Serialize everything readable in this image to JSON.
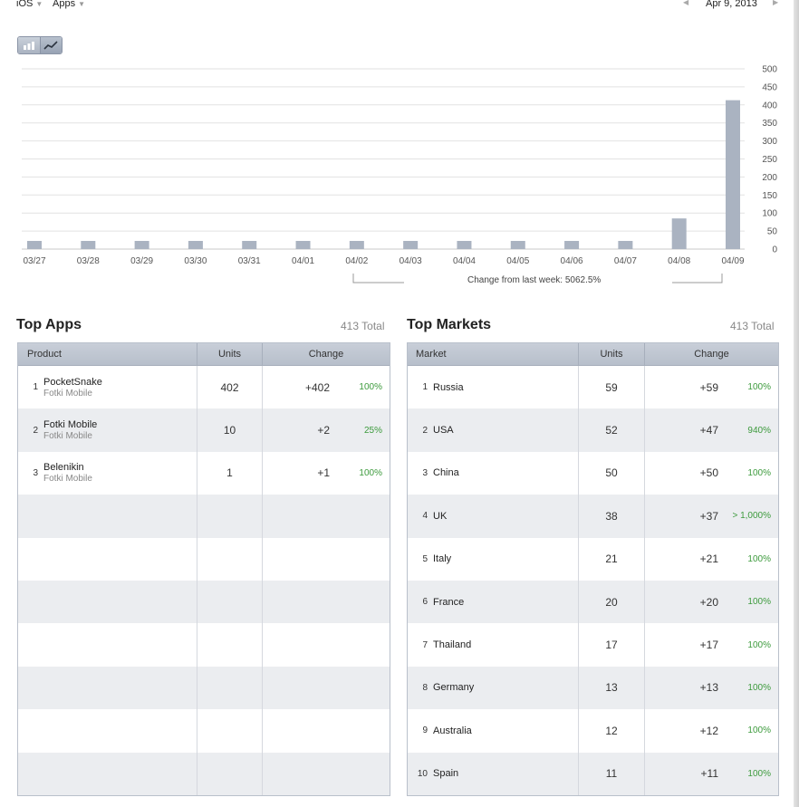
{
  "header": {
    "platform": "iOS",
    "category": "Apps",
    "date": "Apr 9, 2013"
  },
  "chart_data": {
    "type": "bar",
    "categories": [
      "03/27",
      "03/28",
      "03/29",
      "03/30",
      "03/31",
      "04/01",
      "04/02",
      "04/03",
      "04/04",
      "04/05",
      "04/06",
      "04/07",
      "04/08",
      "04/09"
    ],
    "values": [
      0,
      0,
      0,
      0,
      0,
      0,
      0,
      0,
      0,
      0,
      0,
      0,
      85,
      413
    ],
    "ylim": [
      0,
      500
    ],
    "yticks": [
      "0",
      "50",
      "100",
      "150",
      "200",
      "250",
      "300",
      "350",
      "400",
      "450",
      "500"
    ],
    "bar_color": "#aab3c1",
    "grid": true
  },
  "change_from_last_week": "Change from last week: 5062.5%",
  "top_apps": {
    "title": "Top Apps",
    "total": "413 Total",
    "columns": [
      "Product",
      "Units",
      "Change"
    ],
    "rows": [
      {
        "rank": "1",
        "name": "PocketSnake",
        "developer": "Fotki Mobile",
        "units": "402",
        "change": "+402",
        "pct": "100%"
      },
      {
        "rank": "2",
        "name": "Fotki Mobile",
        "developer": "Fotki Mobile",
        "units": "10",
        "change": "+2",
        "pct": "25%"
      },
      {
        "rank": "3",
        "name": "Belenikin",
        "developer": "Fotki Mobile",
        "units": "1",
        "change": "+1",
        "pct": "100%"
      }
    ]
  },
  "top_markets": {
    "title": "Top Markets",
    "total": "413 Total",
    "columns": [
      "Market",
      "Units",
      "Change"
    ],
    "rows": [
      {
        "rank": "1",
        "name": "Russia",
        "units": "59",
        "change": "+59",
        "pct": "100%"
      },
      {
        "rank": "2",
        "name": "USA",
        "units": "52",
        "change": "+47",
        "pct": "940%"
      },
      {
        "rank": "3",
        "name": "China",
        "units": "50",
        "change": "+50",
        "pct": "100%"
      },
      {
        "rank": "4",
        "name": "UK",
        "units": "38",
        "change": "+37",
        "pct": "> 1,000%"
      },
      {
        "rank": "5",
        "name": "Italy",
        "units": "21",
        "change": "+21",
        "pct": "100%"
      },
      {
        "rank": "6",
        "name": "France",
        "units": "20",
        "change": "+20",
        "pct": "100%"
      },
      {
        "rank": "7",
        "name": "Thailand",
        "units": "17",
        "change": "+17",
        "pct": "100%"
      },
      {
        "rank": "8",
        "name": "Germany",
        "units": "13",
        "change": "+13",
        "pct": "100%"
      },
      {
        "rank": "9",
        "name": "Australia",
        "units": "12",
        "change": "+12",
        "pct": "100%"
      },
      {
        "rank": "10",
        "name": "Spain",
        "units": "11",
        "change": "+11",
        "pct": "100%"
      }
    ]
  },
  "colors": {
    "positive": "#3c9a3c",
    "table_header": "#bcc3ce"
  },
  "icons": {
    "bar_view": "bar-chart-icon",
    "line_view": "line-chart-icon",
    "prev": "triangle-left-icon",
    "next": "triangle-right-icon",
    "dropdown": "triangle-down-icon"
  }
}
